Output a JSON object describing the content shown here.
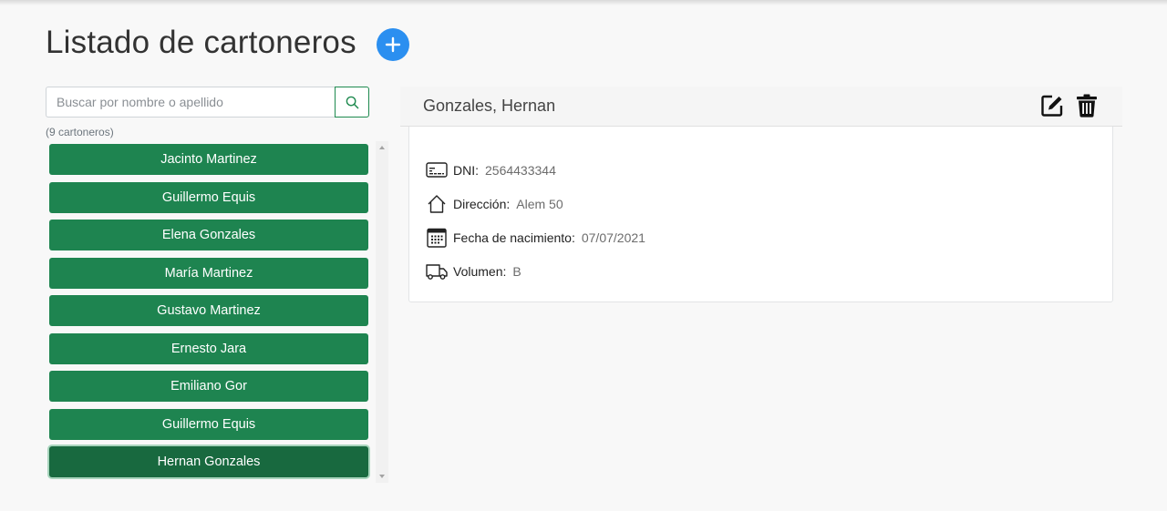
{
  "page": {
    "title": "Listado de cartoneros",
    "add_icon": "plus-circle-icon",
    "accent_color": "#2b8ff0"
  },
  "search": {
    "placeholder": "Buscar por nombre o apellido",
    "value": "",
    "button_icon": "search-icon"
  },
  "list": {
    "count_label": "(9 cartoneros)",
    "item_color": "#1e8450",
    "items": [
      {
        "name": "Jacinto Martinez",
        "active": false
      },
      {
        "name": "Guillermo Equis",
        "active": false
      },
      {
        "name": "Elena Gonzales",
        "active": false
      },
      {
        "name": "María Martinez",
        "active": false
      },
      {
        "name": "Gustavo Martinez",
        "active": false
      },
      {
        "name": "Ernesto Jara",
        "active": false
      },
      {
        "name": "Emiliano Gor",
        "active": false
      },
      {
        "name": "Guillermo Equis",
        "active": false
      },
      {
        "name": "Hernan Gonzales",
        "active": true
      }
    ]
  },
  "detail": {
    "name": "Gonzales, Hernan",
    "edit_icon": "edit-icon",
    "delete_icon": "trash-icon",
    "fields": [
      {
        "icon": "id-card-icon",
        "label": "DNI:",
        "value": "2564433344"
      },
      {
        "icon": "house-icon",
        "label": "Dirección:",
        "value": "Alem 50"
      },
      {
        "icon": "calendar-icon",
        "label": "Fecha de nacimiento:",
        "value": "07/07/2021"
      },
      {
        "icon": "truck-icon",
        "label": "Volumen:",
        "value": "B"
      }
    ]
  }
}
